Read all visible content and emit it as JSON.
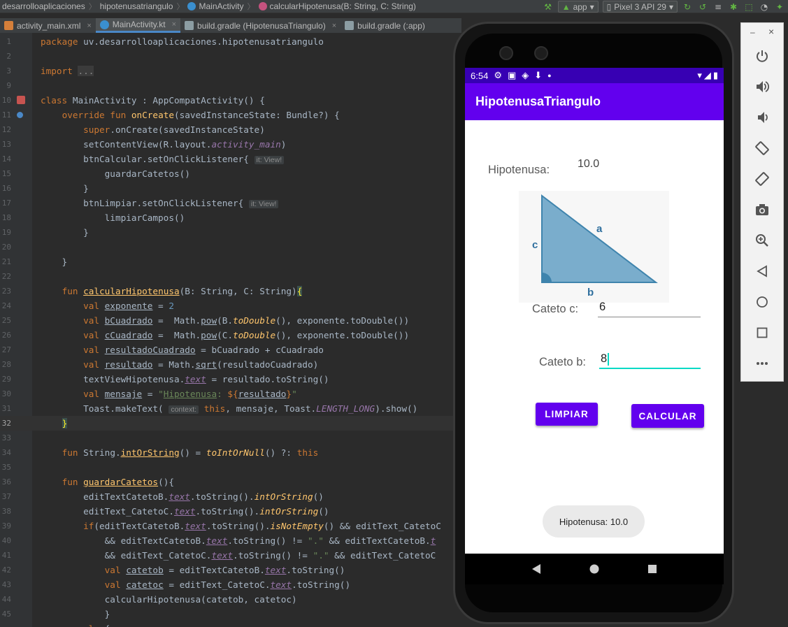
{
  "navbar": {
    "breadcrumbs": [
      "desarrolloaplicaciones",
      "hipotenusatriangulo",
      "MainActivity",
      "calcularHipotenusa(B: String, C: String)"
    ],
    "run_config": "app",
    "device": "Pixel 3 API 29"
  },
  "tabs": [
    {
      "label": "activity_main.xml"
    },
    {
      "label": "MainActivity.kt"
    },
    {
      "label": "build.gradle (HipotenusaTriangulo)"
    },
    {
      "label": "build.gradle (:app)"
    }
  ],
  "code": {
    "line_numbers": [
      "1",
      "2",
      "3",
      "9",
      "10",
      "11",
      "12",
      "13",
      "14",
      "15",
      "16",
      "17",
      "18",
      "19",
      "20",
      "21",
      "22",
      "23",
      "24",
      "25",
      "26",
      "27",
      "28",
      "29",
      "30",
      "31",
      "32",
      "33",
      "34",
      "35",
      "36",
      "37",
      "38",
      "39",
      "40",
      "41",
      "42",
      "43",
      "44",
      "45"
    ],
    "current_line": "32",
    "hints": {
      "it_view": "it: View!",
      "context": "context:"
    },
    "fold_text": "..."
  },
  "phone": {
    "status_time": "6:54",
    "app_title": "HipotenusaTriangulo",
    "hipotenusa_label": "Hipotenusa:",
    "hipotenusa_value": "10.0",
    "triangle": {
      "label_a": "a",
      "label_b": "b",
      "label_c": "c"
    },
    "cateto_c_label": "Cateto c:",
    "cateto_c_value": "6",
    "cateto_b_label": "Cateto b:",
    "cateto_b_value": "8",
    "btn_limpiar": "LIMPIAR",
    "btn_calcular": "CALCULAR",
    "toast_text": "Hipotenusa: 10.0"
  },
  "emulator_sidebar": {
    "minimize": "–",
    "close": "×",
    "buttons": [
      "power-icon",
      "volume-up-icon",
      "volume-down-icon",
      "rotate-left-icon",
      "rotate-right-icon",
      "camera-icon",
      "zoom-icon",
      "back-icon",
      "home-icon",
      "overview-icon",
      "more-icon"
    ]
  },
  "colors": {
    "app_primary": "#6200ee",
    "status_bar": "#3700b3",
    "accent": "#03dac5"
  }
}
